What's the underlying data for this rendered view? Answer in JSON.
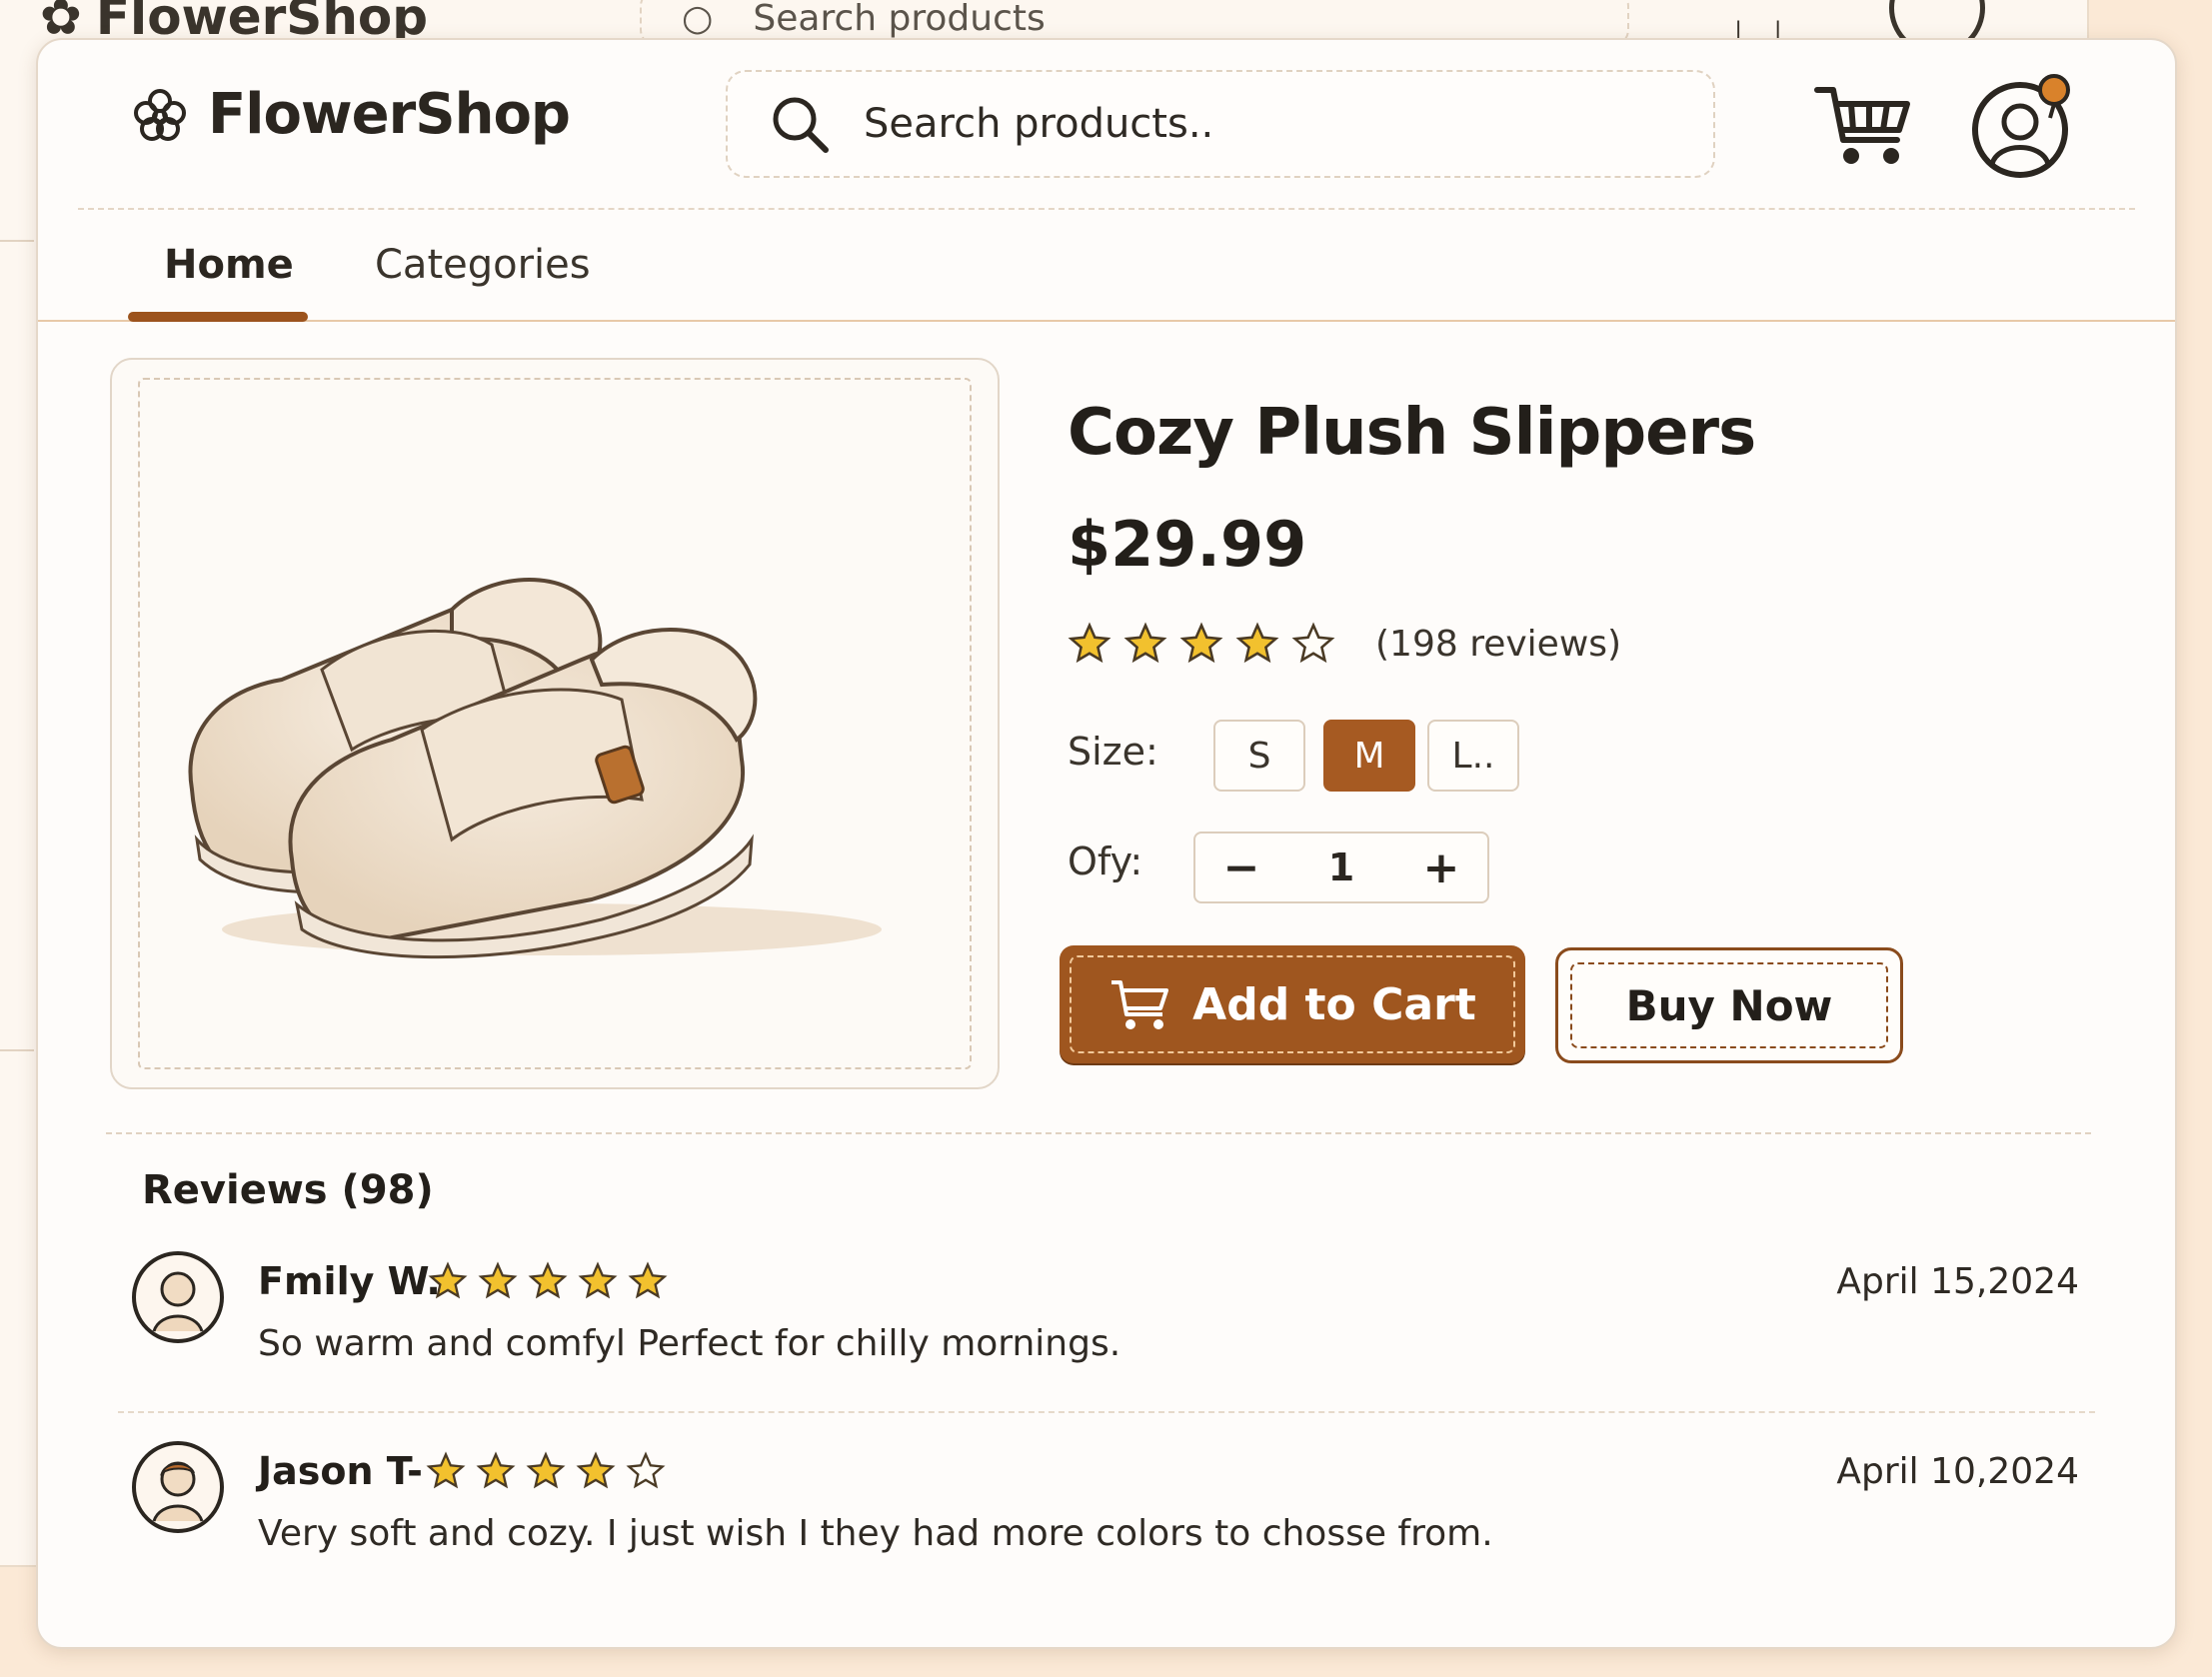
{
  "ghost": {
    "logo": "FlowerShop",
    "search_placeholder": "Search products"
  },
  "header": {
    "logo_text": "FlowerShop",
    "search_placeholder": "Search products..",
    "icons": [
      "flower-icon",
      "search-icon",
      "cart-icon",
      "user-avatar-icon"
    ]
  },
  "nav": {
    "tabs": [
      {
        "label": "Home",
        "active": true
      },
      {
        "label": "Categories",
        "active": false
      }
    ]
  },
  "product": {
    "title": "Cozy Plush Slippers",
    "price": "$29.99",
    "rating": 4,
    "rating_max": 5,
    "reviews_count": "(198 reviews)",
    "size_label": "Size:",
    "sizes": [
      {
        "label": "S",
        "selected": false
      },
      {
        "label": "M",
        "selected": true
      },
      {
        "label": "L..",
        "selected": false
      }
    ],
    "qty_label": "Ofy:",
    "qty_minus": "−",
    "qty_value": "1",
    "qty_plus": "+",
    "add_to_cart": "Add to Cart",
    "buy_now": "Buy Now"
  },
  "reviews": {
    "title": "Reviews (98)",
    "items": [
      {
        "name": "Fmily W.",
        "stars": 5,
        "date": "April 15,2024",
        "text": "So warm and comfyl Perfect for chilly mornings."
      },
      {
        "name": "Jason T-",
        "stars": 4,
        "date": "April 10,2024",
        "text": "Very soft and cozy. I just wish I they had more colors to chosse from."
      }
    ]
  },
  "colors": {
    "accent": "#9f561f",
    "star_fill": "#f2c12e",
    "background": "#fbe9d6"
  }
}
